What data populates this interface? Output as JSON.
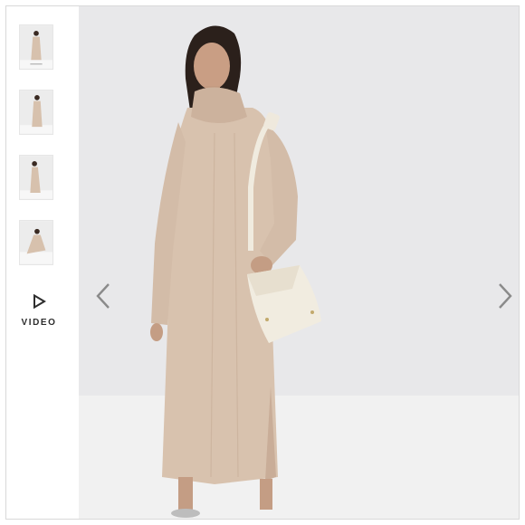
{
  "gallery": {
    "thumbnails": [
      {
        "icon": "dress-photo-front"
      },
      {
        "icon": "dress-photo-back"
      },
      {
        "icon": "dress-photo-side"
      },
      {
        "icon": "dress-photo-seated"
      }
    ],
    "video_label": "VIDEO",
    "video_icon": "play-outline-icon",
    "prev_icon": "chevron-left-icon",
    "next_icon": "chevron-right-icon"
  },
  "colors": {
    "background": "#e9e9eb",
    "floor": "#f2f2f2",
    "dress": "#d9c3b0",
    "bag": "#f1ece0",
    "arrow": "#8a8a8a"
  }
}
